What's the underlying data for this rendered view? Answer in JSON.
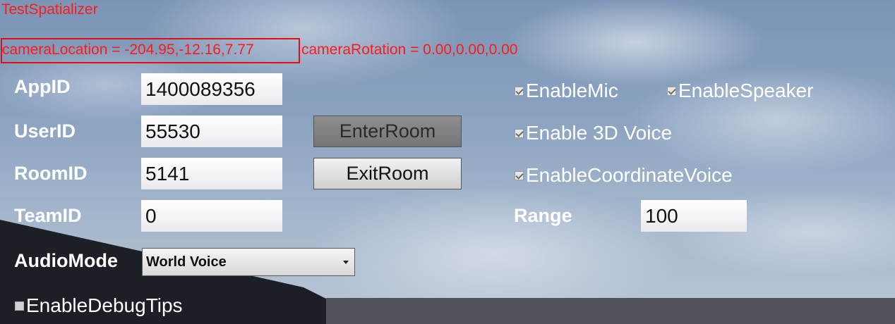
{
  "app": {
    "title": "TestSpatializer"
  },
  "debug": {
    "camera_location": "cameraLocation = -204.95,-12.16,7.77",
    "camera_rotation": "cameraRotation = 0.00,0.00,0.00"
  },
  "form": {
    "app_id_label": "AppID",
    "app_id_value": "1400089356",
    "user_id_label": "UserID",
    "user_id_value": "55530",
    "room_id_label": "RoomID",
    "room_id_value": "5141",
    "team_id_label": "TeamID",
    "team_id_value": "0",
    "audio_mode_label": "AudioMode",
    "audio_mode_selected": "World Voice",
    "range_label": "Range",
    "range_value": "100"
  },
  "buttons": {
    "enter_room": "EnterRoom",
    "exit_room": "ExitRoom"
  },
  "options": {
    "enable_mic": {
      "label": "EnableMic",
      "checked": true
    },
    "enable_speaker": {
      "label": "EnableSpeaker",
      "checked": true
    },
    "enable_3d_voice": {
      "label": "Enable 3D Voice",
      "checked": true
    },
    "enable_coordinate_voice": {
      "label": "EnableCoordinateVoice",
      "checked": true
    },
    "enable_debug_tips": {
      "label": "EnableDebugTips",
      "checked": false
    }
  },
  "colors": {
    "debug_text": "#ff1a1a",
    "enter_room_disabled": "#808080",
    "ground_dark": "#1c1f26"
  }
}
